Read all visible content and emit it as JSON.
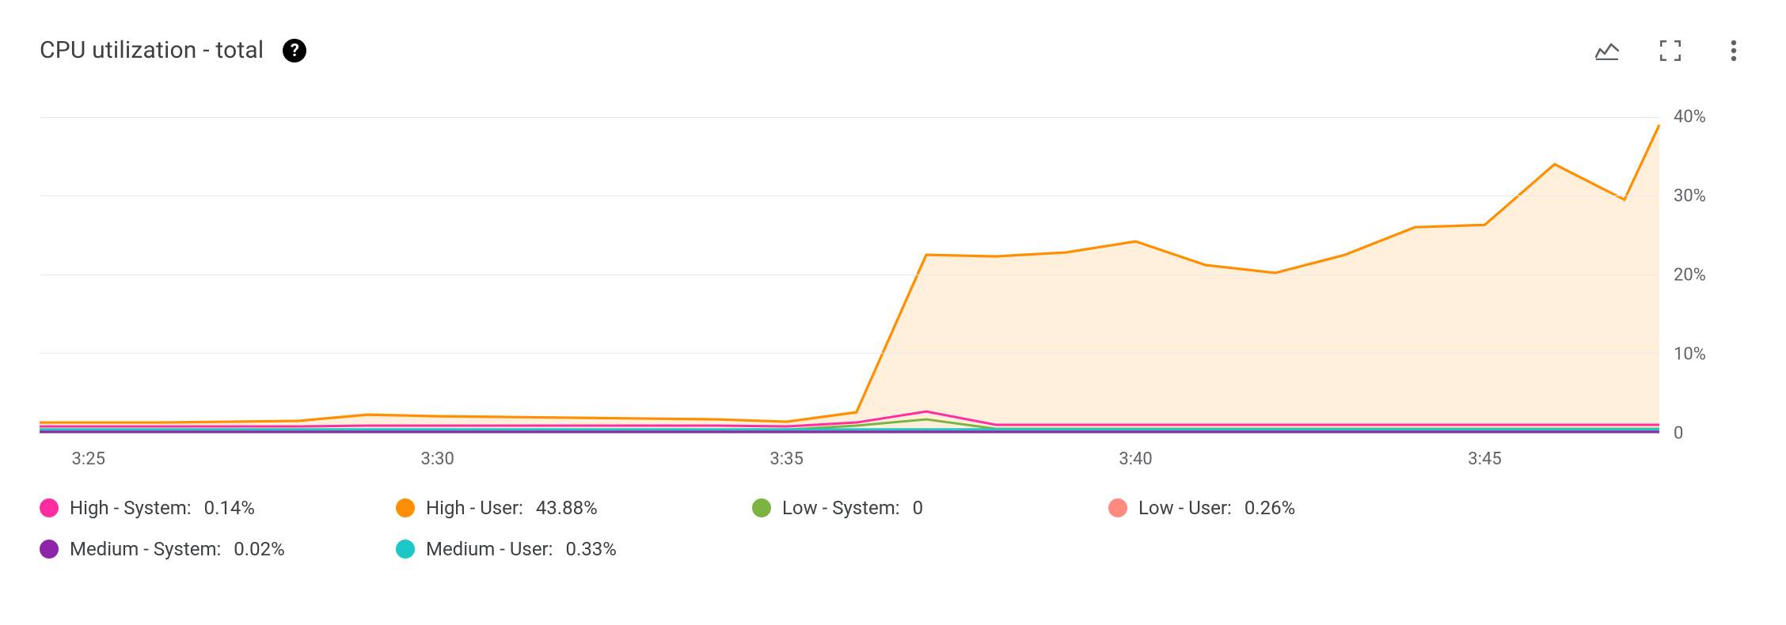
{
  "header": {
    "title": "CPU utilization - total"
  },
  "colors": {
    "high_system": "#ff2da0",
    "high_user": "#ff8f00",
    "low_system": "#7cb342",
    "low_user": "#ff8a80",
    "medium_system": "#8e24aa",
    "medium_user": "#1ec7c7"
  },
  "legend": [
    {
      "key": "high_system",
      "name": "High - System:",
      "value": "0.14%"
    },
    {
      "key": "high_user",
      "name": "High - User:",
      "value": "43.88%"
    },
    {
      "key": "low_system",
      "name": "Low - System:",
      "value": "0"
    },
    {
      "key": "low_user",
      "name": "Low - User:",
      "value": "0.26%"
    },
    {
      "key": "medium_system",
      "name": "Medium - System:",
      "value": "0.02%"
    },
    {
      "key": "medium_user",
      "name": "Medium - User:",
      "value": "0.33%"
    }
  ],
  "chart_data": {
    "type": "area",
    "xlabel": "",
    "ylabel": "",
    "title": "CPU utilization - total",
    "x_ticks": [
      "3:25",
      "3:30",
      "3:35",
      "3:40",
      "3:45"
    ],
    "y_ticks": [
      "0",
      "10%",
      "20%",
      "30%",
      "40%"
    ],
    "xlim": [
      24.3,
      47.5
    ],
    "ylim": [
      0,
      43
    ],
    "x": [
      24.3,
      25,
      26,
      27,
      28,
      29,
      30,
      31,
      32,
      33,
      34,
      35,
      36,
      37,
      38,
      39,
      40,
      41,
      42,
      43,
      44,
      45,
      46,
      47,
      47.5
    ],
    "series": [
      {
        "name": "High - User",
        "key": "high_user",
        "fill": true,
        "values": [
          1.2,
          1.2,
          1.2,
          1.3,
          1.4,
          2.2,
          2.0,
          1.9,
          1.8,
          1.7,
          1.6,
          1.3,
          2.5,
          22.5,
          22.3,
          22.8,
          24.2,
          21.2,
          20.2,
          22.5,
          26.0,
          26.3,
          34.0,
          29.5,
          39.0
        ]
      },
      {
        "name": "High - System",
        "key": "high_system",
        "fill": false,
        "values": [
          0.7,
          0.7,
          0.7,
          0.7,
          0.7,
          0.8,
          0.8,
          0.8,
          0.8,
          0.8,
          0.8,
          0.7,
          1.2,
          2.6,
          0.9,
          0.9,
          0.9,
          0.9,
          0.9,
          0.9,
          0.9,
          0.9,
          0.9,
          0.9,
          0.9
        ]
      },
      {
        "name": "Low - System",
        "key": "low_system",
        "fill": false,
        "values": [
          0.3,
          0.3,
          0.3,
          0.3,
          0.3,
          0.3,
          0.3,
          0.3,
          0.3,
          0.3,
          0.3,
          0.3,
          0.8,
          1.6,
          0.4,
          0.4,
          0.4,
          0.4,
          0.4,
          0.4,
          0.4,
          0.4,
          0.4,
          0.4,
          0.4
        ]
      },
      {
        "name": "Low - User",
        "key": "low_user",
        "fill": false,
        "values": [
          0.25,
          0.25,
          0.25,
          0.25,
          0.25,
          0.25,
          0.25,
          0.25,
          0.25,
          0.25,
          0.25,
          0.25,
          0.25,
          0.25,
          0.25,
          0.25,
          0.25,
          0.25,
          0.25,
          0.25,
          0.25,
          0.25,
          0.25,
          0.25,
          0.25
        ]
      },
      {
        "name": "Medium - System",
        "key": "medium_system",
        "fill": false,
        "values": [
          0.02,
          0.02,
          0.02,
          0.02,
          0.02,
          0.02,
          0.02,
          0.02,
          0.02,
          0.02,
          0.02,
          0.02,
          0.02,
          0.02,
          0.02,
          0.02,
          0.02,
          0.02,
          0.02,
          0.02,
          0.02,
          0.02,
          0.02,
          0.02,
          0.02
        ]
      },
      {
        "name": "Medium - User",
        "key": "medium_user",
        "fill": false,
        "values": [
          0.33,
          0.33,
          0.33,
          0.33,
          0.33,
          0.33,
          0.33,
          0.33,
          0.33,
          0.33,
          0.33,
          0.33,
          0.33,
          0.33,
          0.33,
          0.33,
          0.33,
          0.33,
          0.33,
          0.33,
          0.33,
          0.33,
          0.33,
          0.33,
          0.33
        ]
      }
    ]
  }
}
